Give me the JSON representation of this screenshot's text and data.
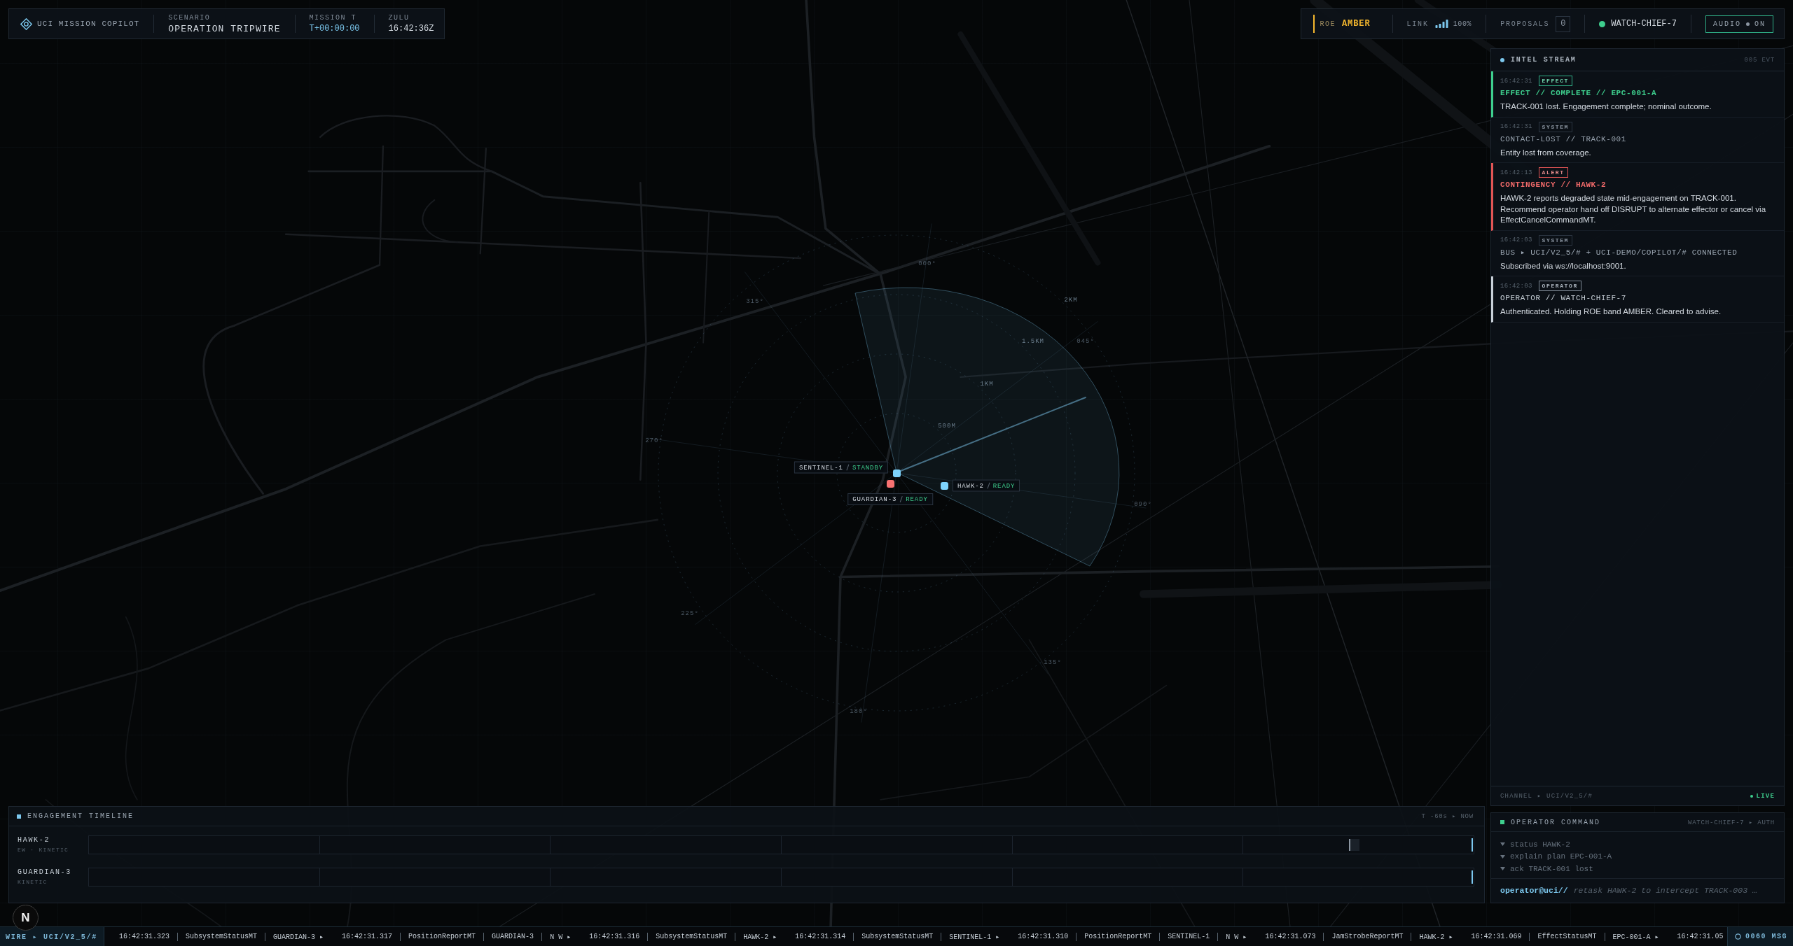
{
  "header": {
    "title": "UCI MISSION COPILOT",
    "fields": [
      {
        "label": "SCENARIO",
        "value": "OPERATION TRIPWIRE",
        "kind": "name"
      },
      {
        "label": "MISSION T",
        "value": "T+00:00:00",
        "kind": "timer"
      },
      {
        "label": "ZULU",
        "value": "16:42:36Z",
        "kind": "clock"
      }
    ]
  },
  "status": {
    "roe_label": "ROE",
    "roe_band": "AMBER",
    "link_label": "LINK",
    "link_value": "100%",
    "proposals_label": "PROPOSALS",
    "proposals_count": "0",
    "operator": "WATCH-CHIEF-7",
    "operator_online": true,
    "audio": {
      "label": "AUDIO",
      "value": "ON",
      "on": true
    }
  },
  "map": {
    "bearings": [
      "000°",
      "045°",
      "090°",
      "135°",
      "180°",
      "225°",
      "270°",
      "315°"
    ],
    "ranges": [
      "500M",
      "1KM",
      "1.5KM",
      "2KM"
    ],
    "units": [
      {
        "name": "SENTINEL-1",
        "status": "STANDBY",
        "color": "#7dd3fc"
      },
      {
        "name": "GUARDIAN-3",
        "status": "READY",
        "color": "#f87171"
      },
      {
        "name": "HAWK-2",
        "status": "READY",
        "color": "#7dd3fc"
      }
    ]
  },
  "intel_stream": {
    "title": "INTEL STREAM",
    "count": "005 EVT",
    "events": [
      {
        "time": "16:42:31",
        "kind": "effect",
        "tag": "EFFECT",
        "title": "EFFECT // COMPLETE // EPC-001-A",
        "body": "TRACK-001 lost. Engagement complete; nominal outcome."
      },
      {
        "time": "16:42:31",
        "kind": "system",
        "tag": "SYSTEM",
        "title": "CONTACT-LOST // TRACK-001",
        "body": "Entity lost from coverage."
      },
      {
        "time": "16:42:13",
        "kind": "alert",
        "tag": "ALERT",
        "title": "CONTINGENCY // HAWK-2",
        "body": "HAWK-2 reports degraded state mid-engagement on TRACK-001. Recommend operator hand off DISRUPT to alternate effector or cancel via EffectCancelCommandMT."
      },
      {
        "time": "16:42:03",
        "kind": "system",
        "tag": "SYSTEM",
        "title": "BUS ▸ UCI/V2_5/# + UCI-DEMO/COPILOT/# CONNECTED",
        "body": "Subscribed via ws://localhost:9001."
      },
      {
        "time": "16:42:03",
        "kind": "operator",
        "tag": "OPERATOR",
        "title": "OPERATOR // WATCH-CHIEF-7",
        "body": "Authenticated. Holding ROE band AMBER. Cleared to advise."
      }
    ],
    "channel": "CHANNEL ▸ UCI/V2_5/#",
    "live_label": "LIVE",
    "live": true
  },
  "timeline": {
    "title": "ENGAGEMENT TIMELINE",
    "window": "T -60s ▸ NOW",
    "rows": [
      {
        "name": "HAWK-2",
        "roles": "EW · KINETIC",
        "events": [
          {
            "level": 0.91
          }
        ]
      },
      {
        "name": "GUARDIAN-3",
        "roles": "KINETIC"
      }
    ]
  },
  "operator_command": {
    "title": "OPERATOR COMMAND",
    "context": "WATCH-CHIEF-7 ▸ AUTH",
    "suggestions": [
      "status HAWK-2",
      "explain plan EPC-001-A",
      "ack TRACK-001 lost"
    ],
    "prompt": "operator@uci//",
    "placeholder": "retask HAWK-2 to intercept TRACK-003 …"
  },
  "wire": {
    "label": "WIRE ▸ UCI/V2_5/#",
    "messages": [
      {
        "parts": [
          "16:42:31.323",
          "SubsystemStatusMT",
          "GUARDIAN-3 ▸"
        ]
      },
      {
        "parts": [
          "16:42:31.317",
          "PositionReportMT",
          "GUARDIAN-3",
          "N W ▸"
        ]
      },
      {
        "parts": [
          "16:42:31.316",
          "SubsystemStatusMT",
          "HAWK-2 ▸"
        ]
      },
      {
        "parts": [
          "16:42:31.314",
          "SubsystemStatusMT",
          "SENTINEL-1 ▸"
        ]
      },
      {
        "parts": [
          "16:42:31.310",
          "PositionReportMT",
          "SENTINEL-1",
          "N W ▸"
        ]
      },
      {
        "parts": [
          "16:42:31.073",
          "JamStrobeReportMT",
          "HAWK-2 ▸"
        ]
      },
      {
        "parts": [
          "16:42:31.069",
          "EffectStatusMT",
          "EPC-001-A ▸"
        ]
      },
      {
        "parts": [
          "16:42:31.05"
        ]
      }
    ],
    "count": "0060 MSG"
  },
  "dev_badge": {
    "label": "N"
  }
}
